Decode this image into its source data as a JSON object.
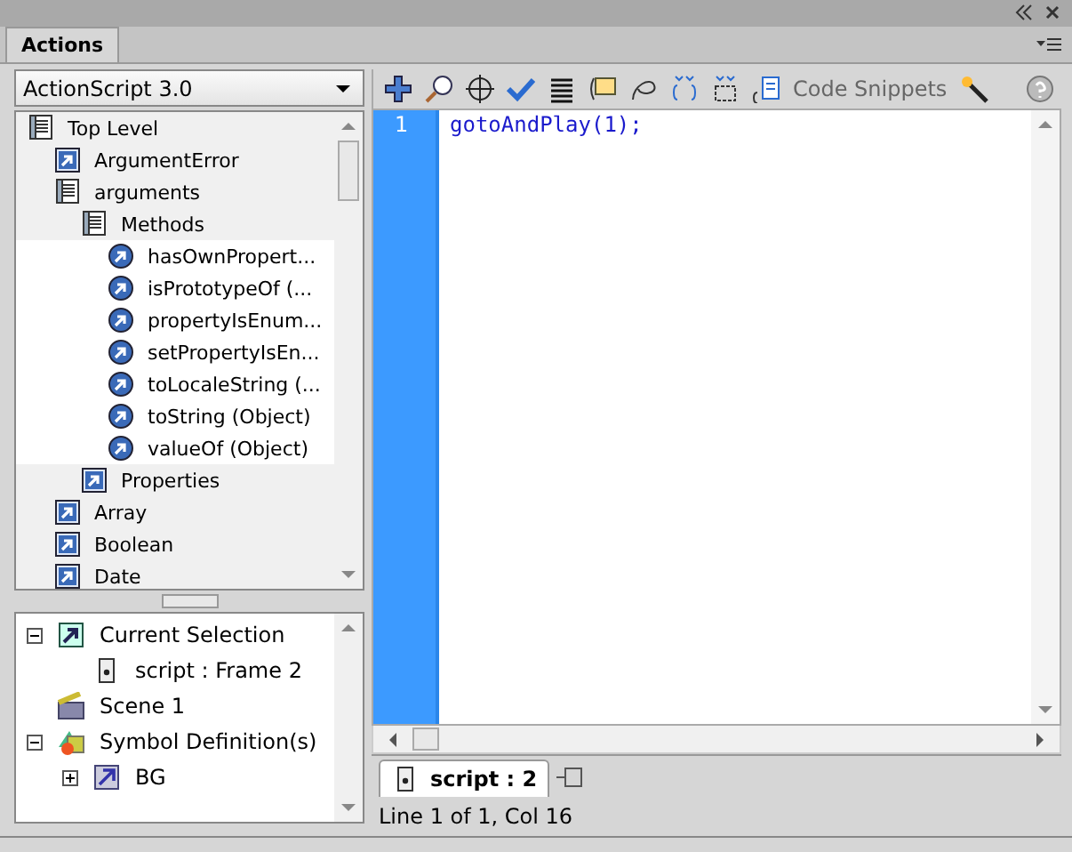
{
  "panel": {
    "tab": "Actions"
  },
  "language": {
    "value": "ActionScript 3.0"
  },
  "toolbox": [
    {
      "label": "Top Level",
      "kind": "book",
      "children": [
        {
          "label": "ArgumentError",
          "kind": "class"
        },
        {
          "label": "arguments",
          "kind": "book",
          "children": [
            {
              "label": "Methods",
              "kind": "book",
              "children": [
                {
                  "label": "hasOwnPropert...",
                  "kind": "method"
                },
                {
                  "label": "isPrototypeOf (...",
                  "kind": "method"
                },
                {
                  "label": "propertyIsEnum...",
                  "kind": "method"
                },
                {
                  "label": "setPropertyIsEn...",
                  "kind": "method"
                },
                {
                  "label": "toLocaleString (...",
                  "kind": "method"
                },
                {
                  "label": "toString (Object)",
                  "kind": "method"
                },
                {
                  "label": "valueOf (Object)",
                  "kind": "method"
                }
              ]
            },
            {
              "label": "Properties",
              "kind": "class"
            }
          ]
        },
        {
          "label": "Array",
          "kind": "class"
        },
        {
          "label": "Boolean",
          "kind": "class"
        },
        {
          "label": "Date",
          "kind": "class"
        }
      ]
    }
  ],
  "script_navigator": [
    {
      "label": "Current Selection",
      "kind": "selection",
      "expanded": true,
      "children": [
        {
          "label": "script : Frame 2",
          "kind": "script"
        }
      ]
    },
    {
      "label": "Scene 1",
      "kind": "scene"
    },
    {
      "label": "Symbol Definition(s)",
      "kind": "symbols",
      "expanded": true,
      "children": [
        {
          "label": "BG",
          "kind": "movieclip",
          "expanded": false
        }
      ]
    }
  ],
  "toolbar": {
    "code_snippets": "Code Snippets"
  },
  "editor": {
    "lines": [
      {
        "number": "1",
        "code": "gotoAndPlay(1);"
      }
    ]
  },
  "script_tab": {
    "label": "script : 2"
  },
  "status_bar": "Line 1 of 1, Col 16"
}
